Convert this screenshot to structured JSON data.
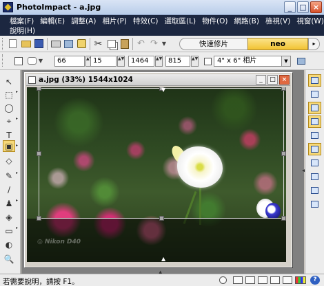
{
  "window": {
    "title": "PhotoImpact - a.jpg",
    "minimize_label": "_",
    "maximize_label": "□",
    "close_label": "×"
  },
  "menu": {
    "row1": [
      "檔案(F)",
      "編輯(E)",
      "調整(A)",
      "相片(P)",
      "特效(C)",
      "選取區(L)",
      "物件(O)",
      "網路(B)",
      "檢視(V)",
      "視窗(W)"
    ],
    "row2": [
      "說明(H)"
    ]
  },
  "toolbar": {
    "quick_tab": "快速修片",
    "neo_tab": "neo",
    "neo_menu": "▸",
    "cut_glyph": "✂",
    "undo_glyph": "↶",
    "redo_glyph": "↷"
  },
  "attributes": {
    "field1": "66",
    "field2": "15",
    "field3": "1464",
    "field4": "815",
    "preset": "4\" x 6\" 相片",
    "spin_glyph": "▲▼",
    "dropdown_glyph": "▼"
  },
  "document": {
    "title": "a.jpg (33%) 1544x1024",
    "watermark": "◎ Nikon D40",
    "min_label": "_",
    "max_label": "□",
    "close_label": "×"
  },
  "tools": {
    "glyphs": [
      "↖",
      "⬚",
      "◯",
      "⌖",
      "T",
      "⌗",
      "▣",
      "◇",
      "✎",
      "∕",
      "♟",
      "◈",
      "▭",
      "◐",
      "🔍"
    ],
    "active_index": 6
  },
  "statusbar": {
    "text": "若需要說明，請按 F1。",
    "help": "?"
  }
}
